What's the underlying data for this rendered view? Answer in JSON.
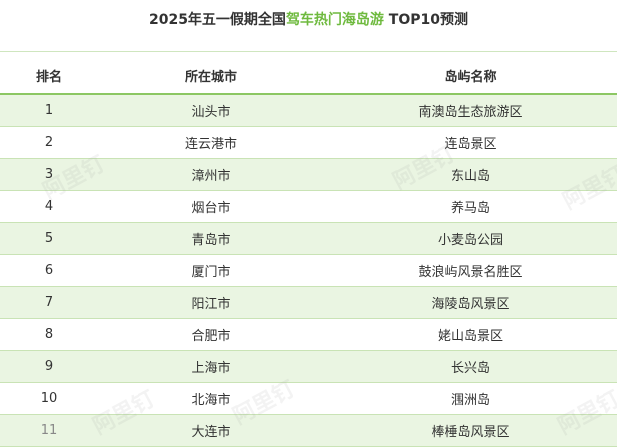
{
  "title": {
    "prefix": "2025年五一假期全国",
    "highlight": "驾车热门海岛游",
    "suffix": " TOP10预测"
  },
  "colors": {
    "accent": "#6fba3f",
    "header_rule": "#8cc763",
    "row_alt_bg": "#eaf5e2"
  },
  "table": {
    "columns": [
      "排名",
      "所在城市",
      "岛屿名称"
    ],
    "rows": [
      {
        "rank": "1",
        "city": "汕头市",
        "island": "南澳岛生态旅游区"
      },
      {
        "rank": "2",
        "city": "连云港市",
        "island": "连岛景区"
      },
      {
        "rank": "3",
        "city": "漳州市",
        "island": "东山岛"
      },
      {
        "rank": "4",
        "city": "烟台市",
        "island": "养马岛"
      },
      {
        "rank": "5",
        "city": "青岛市",
        "island": "小麦岛公园"
      },
      {
        "rank": "6",
        "city": "厦门市",
        "island": "鼓浪屿风景名胜区"
      },
      {
        "rank": "7",
        "city": "阳江市",
        "island": "海陵岛风景区"
      },
      {
        "rank": "8",
        "city": "合肥市",
        "island": "姥山岛景区"
      },
      {
        "rank": "9",
        "city": "上海市",
        "island": "长兴岛"
      },
      {
        "rank": "10",
        "city": "北海市",
        "island": "涠洲岛"
      },
      {
        "rank": "11",
        "city": "大连市",
        "island": "棒棰岛风景区"
      }
    ]
  },
  "watermark": {
    "text": "阿里钉"
  }
}
